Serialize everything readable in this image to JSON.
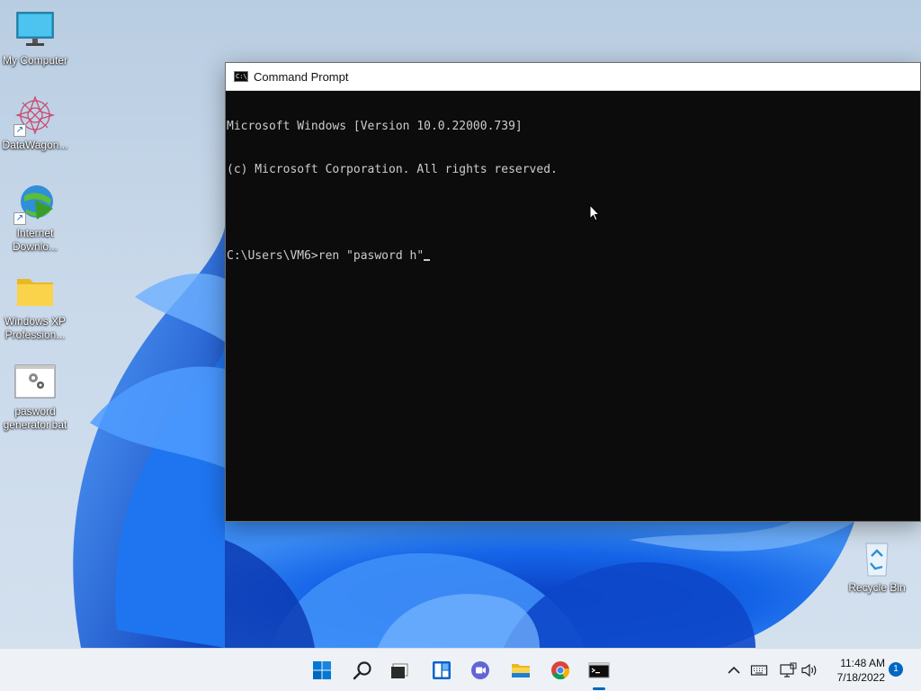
{
  "desktop": {
    "icons": [
      {
        "label": "My Computer",
        "icon": "monitor-icon"
      },
      {
        "label": "DataWagon...",
        "icon": "datawagon-icon"
      },
      {
        "label": "Internet Downlo...",
        "icon": "internet-download-manager-icon"
      },
      {
        "label": "Windows XP Profession...",
        "icon": "folder-icon"
      },
      {
        "label": "pasword generator.bat",
        "icon": "batch-file-icon"
      }
    ],
    "recycle_bin": {
      "label": "Recycle Bin",
      "icon": "recycle-bin-icon"
    }
  },
  "cmd_window": {
    "title": "Command Prompt",
    "icon_text": "C:\\_",
    "lines": [
      "Microsoft Windows [Version 10.0.22000.739]",
      "(c) Microsoft Corporation. All rights reserved.",
      "",
      "C:\\Users\\VM6>ren \"pasword h\""
    ]
  },
  "taskbar": {
    "apps": [
      {
        "name": "Start",
        "icon": "windows-start-icon"
      },
      {
        "name": "Search",
        "icon": "search-icon"
      },
      {
        "name": "Task View",
        "icon": "task-view-icon"
      },
      {
        "name": "Widgets",
        "icon": "widgets-icon"
      },
      {
        "name": "Chat",
        "icon": "chat-icon"
      },
      {
        "name": "File Explorer",
        "icon": "file-explorer-icon"
      },
      {
        "name": "Google Chrome",
        "icon": "chrome-icon"
      },
      {
        "name": "Command Prompt",
        "icon": "command-prompt-icon",
        "active": true
      }
    ],
    "tray": {
      "icons": [
        "chevron-up-icon",
        "keyboard-icon",
        "network-icon",
        "volume-icon"
      ],
      "time": "11:48 AM",
      "date": "7/18/2022",
      "notifications": "1"
    }
  },
  "colors": {
    "accent": "#0067c0",
    "console_bg": "#0c0c0c",
    "console_fg": "#cccccc",
    "wallpaper_blue": "#1a6cf0"
  }
}
